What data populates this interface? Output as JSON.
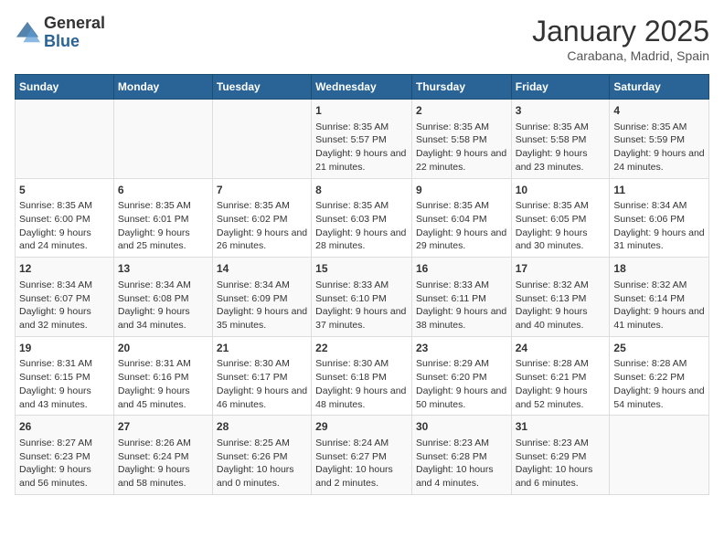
{
  "logo": {
    "general": "General",
    "blue": "Blue"
  },
  "title": "January 2025",
  "location": "Carabana, Madrid, Spain",
  "headers": [
    "Sunday",
    "Monday",
    "Tuesday",
    "Wednesday",
    "Thursday",
    "Friday",
    "Saturday"
  ],
  "weeks": [
    [
      {
        "day": "",
        "sunrise": "",
        "sunset": "",
        "daylight": ""
      },
      {
        "day": "",
        "sunrise": "",
        "sunset": "",
        "daylight": ""
      },
      {
        "day": "",
        "sunrise": "",
        "sunset": "",
        "daylight": ""
      },
      {
        "day": "1",
        "sunrise": "Sunrise: 8:35 AM",
        "sunset": "Sunset: 5:57 PM",
        "daylight": "Daylight: 9 hours and 21 minutes."
      },
      {
        "day": "2",
        "sunrise": "Sunrise: 8:35 AM",
        "sunset": "Sunset: 5:58 PM",
        "daylight": "Daylight: 9 hours and 22 minutes."
      },
      {
        "day": "3",
        "sunrise": "Sunrise: 8:35 AM",
        "sunset": "Sunset: 5:58 PM",
        "daylight": "Daylight: 9 hours and 23 minutes."
      },
      {
        "day": "4",
        "sunrise": "Sunrise: 8:35 AM",
        "sunset": "Sunset: 5:59 PM",
        "daylight": "Daylight: 9 hours and 24 minutes."
      }
    ],
    [
      {
        "day": "5",
        "sunrise": "Sunrise: 8:35 AM",
        "sunset": "Sunset: 6:00 PM",
        "daylight": "Daylight: 9 hours and 24 minutes."
      },
      {
        "day": "6",
        "sunrise": "Sunrise: 8:35 AM",
        "sunset": "Sunset: 6:01 PM",
        "daylight": "Daylight: 9 hours and 25 minutes."
      },
      {
        "day": "7",
        "sunrise": "Sunrise: 8:35 AM",
        "sunset": "Sunset: 6:02 PM",
        "daylight": "Daylight: 9 hours and 26 minutes."
      },
      {
        "day": "8",
        "sunrise": "Sunrise: 8:35 AM",
        "sunset": "Sunset: 6:03 PM",
        "daylight": "Daylight: 9 hours and 28 minutes."
      },
      {
        "day": "9",
        "sunrise": "Sunrise: 8:35 AM",
        "sunset": "Sunset: 6:04 PM",
        "daylight": "Daylight: 9 hours and 29 minutes."
      },
      {
        "day": "10",
        "sunrise": "Sunrise: 8:35 AM",
        "sunset": "Sunset: 6:05 PM",
        "daylight": "Daylight: 9 hours and 30 minutes."
      },
      {
        "day": "11",
        "sunrise": "Sunrise: 8:34 AM",
        "sunset": "Sunset: 6:06 PM",
        "daylight": "Daylight: 9 hours and 31 minutes."
      }
    ],
    [
      {
        "day": "12",
        "sunrise": "Sunrise: 8:34 AM",
        "sunset": "Sunset: 6:07 PM",
        "daylight": "Daylight: 9 hours and 32 minutes."
      },
      {
        "day": "13",
        "sunrise": "Sunrise: 8:34 AM",
        "sunset": "Sunset: 6:08 PM",
        "daylight": "Daylight: 9 hours and 34 minutes."
      },
      {
        "day": "14",
        "sunrise": "Sunrise: 8:34 AM",
        "sunset": "Sunset: 6:09 PM",
        "daylight": "Daylight: 9 hours and 35 minutes."
      },
      {
        "day": "15",
        "sunrise": "Sunrise: 8:33 AM",
        "sunset": "Sunset: 6:10 PM",
        "daylight": "Daylight: 9 hours and 37 minutes."
      },
      {
        "day": "16",
        "sunrise": "Sunrise: 8:33 AM",
        "sunset": "Sunset: 6:11 PM",
        "daylight": "Daylight: 9 hours and 38 minutes."
      },
      {
        "day": "17",
        "sunrise": "Sunrise: 8:32 AM",
        "sunset": "Sunset: 6:13 PM",
        "daylight": "Daylight: 9 hours and 40 minutes."
      },
      {
        "day": "18",
        "sunrise": "Sunrise: 8:32 AM",
        "sunset": "Sunset: 6:14 PM",
        "daylight": "Daylight: 9 hours and 41 minutes."
      }
    ],
    [
      {
        "day": "19",
        "sunrise": "Sunrise: 8:31 AM",
        "sunset": "Sunset: 6:15 PM",
        "daylight": "Daylight: 9 hours and 43 minutes."
      },
      {
        "day": "20",
        "sunrise": "Sunrise: 8:31 AM",
        "sunset": "Sunset: 6:16 PM",
        "daylight": "Daylight: 9 hours and 45 minutes."
      },
      {
        "day": "21",
        "sunrise": "Sunrise: 8:30 AM",
        "sunset": "Sunset: 6:17 PM",
        "daylight": "Daylight: 9 hours and 46 minutes."
      },
      {
        "day": "22",
        "sunrise": "Sunrise: 8:30 AM",
        "sunset": "Sunset: 6:18 PM",
        "daylight": "Daylight: 9 hours and 48 minutes."
      },
      {
        "day": "23",
        "sunrise": "Sunrise: 8:29 AM",
        "sunset": "Sunset: 6:20 PM",
        "daylight": "Daylight: 9 hours and 50 minutes."
      },
      {
        "day": "24",
        "sunrise": "Sunrise: 8:28 AM",
        "sunset": "Sunset: 6:21 PM",
        "daylight": "Daylight: 9 hours and 52 minutes."
      },
      {
        "day": "25",
        "sunrise": "Sunrise: 8:28 AM",
        "sunset": "Sunset: 6:22 PM",
        "daylight": "Daylight: 9 hours and 54 minutes."
      }
    ],
    [
      {
        "day": "26",
        "sunrise": "Sunrise: 8:27 AM",
        "sunset": "Sunset: 6:23 PM",
        "daylight": "Daylight: 9 hours and 56 minutes."
      },
      {
        "day": "27",
        "sunrise": "Sunrise: 8:26 AM",
        "sunset": "Sunset: 6:24 PM",
        "daylight": "Daylight: 9 hours and 58 minutes."
      },
      {
        "day": "28",
        "sunrise": "Sunrise: 8:25 AM",
        "sunset": "Sunset: 6:26 PM",
        "daylight": "Daylight: 10 hours and 0 minutes."
      },
      {
        "day": "29",
        "sunrise": "Sunrise: 8:24 AM",
        "sunset": "Sunset: 6:27 PM",
        "daylight": "Daylight: 10 hours and 2 minutes."
      },
      {
        "day": "30",
        "sunrise": "Sunrise: 8:23 AM",
        "sunset": "Sunset: 6:28 PM",
        "daylight": "Daylight: 10 hours and 4 minutes."
      },
      {
        "day": "31",
        "sunrise": "Sunrise: 8:23 AM",
        "sunset": "Sunset: 6:29 PM",
        "daylight": "Daylight: 10 hours and 6 minutes."
      },
      {
        "day": "",
        "sunrise": "",
        "sunset": "",
        "daylight": ""
      }
    ]
  ]
}
